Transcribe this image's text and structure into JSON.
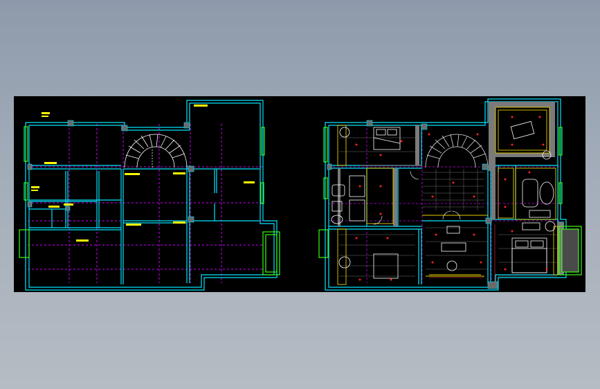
{
  "window": {
    "background_top": "#8e9aab",
    "background_bottom": "#b6bcc3",
    "viewport_color": "#000000"
  },
  "drawing": {
    "colors": {
      "wall": "#00e5ff",
      "window": "#39ff14",
      "grid": "#d400ff",
      "label": "#ffff00",
      "yellow_line": "#e6d000",
      "fixture": "#ffffff",
      "hatch": "#b0b0b0",
      "light": "#ff2020",
      "red_line": "#ff3030"
    },
    "left_plan": {
      "labels": [
        "",
        "",
        "",
        "",
        "",
        "",
        "",
        "",
        "",
        "",
        "",
        ""
      ]
    },
    "right_plan": {
      "labels": []
    }
  }
}
